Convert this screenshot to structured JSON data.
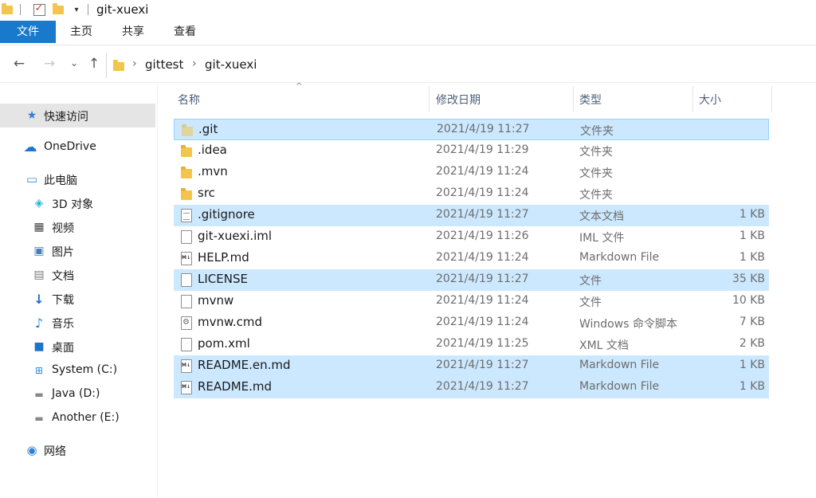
{
  "window": {
    "title": "git-xuexi"
  },
  "ribbon": {
    "tabs": [
      {
        "label": "文件",
        "active": true
      },
      {
        "label": "主页"
      },
      {
        "label": "共享"
      },
      {
        "label": "查看"
      }
    ]
  },
  "nav": {
    "back_icon": "arrow-left-icon",
    "forward_icon": "arrow-right-icon",
    "recent_icon": "chevron-down-icon",
    "up_icon": "arrow-up-icon",
    "breadcrumb": [
      "gittest",
      "git-xuexi"
    ]
  },
  "sidebar": {
    "items": [
      {
        "label": "快速访问",
        "icon": "star-icon",
        "selected": true
      },
      {
        "label": "OneDrive",
        "icon": "cloud-icon"
      },
      {
        "label": "此电脑",
        "icon": "computer-icon"
      },
      {
        "label": "3D 对象",
        "icon": "cube-icon"
      },
      {
        "label": "视频",
        "icon": "film-icon"
      },
      {
        "label": "图片",
        "icon": "picture-icon"
      },
      {
        "label": "文档",
        "icon": "document-icon"
      },
      {
        "label": "下载",
        "icon": "download-icon"
      },
      {
        "label": "音乐",
        "icon": "music-icon"
      },
      {
        "label": "桌面",
        "icon": "desktop-icon"
      },
      {
        "label": "System (C:)",
        "icon": "windows-drive-icon"
      },
      {
        "label": "Java (D:)",
        "icon": "drive-icon"
      },
      {
        "label": "Another (E:)",
        "icon": "drive-icon"
      },
      {
        "label": "网络",
        "icon": "network-icon"
      }
    ]
  },
  "columns": {
    "name": "名称",
    "date": "修改日期",
    "type": "类型",
    "size": "大小"
  },
  "files": [
    {
      "name": ".git",
      "date": "2021/4/19 11:27",
      "type": "文件夹",
      "size": "",
      "icon": "folder-icon",
      "selected": true,
      "faded": true
    },
    {
      "name": ".idea",
      "date": "2021/4/19 11:29",
      "type": "文件夹",
      "size": "",
      "icon": "folder-icon"
    },
    {
      "name": ".mvn",
      "date": "2021/4/19 11:24",
      "type": "文件夹",
      "size": "",
      "icon": "folder-icon"
    },
    {
      "name": "src",
      "date": "2021/4/19 11:24",
      "type": "文件夹",
      "size": "",
      "icon": "folder-icon"
    },
    {
      "name": ".gitignore",
      "date": "2021/4/19 11:27",
      "type": "文本文档",
      "size": "1 KB",
      "icon": "text-file-icon",
      "selected": true
    },
    {
      "name": "git-xuexi.iml",
      "date": "2021/4/19 11:26",
      "type": "IML 文件",
      "size": "1 KB",
      "icon": "file-icon"
    },
    {
      "name": "HELP.md",
      "date": "2021/4/19 11:24",
      "type": "Markdown File",
      "size": "1 KB",
      "icon": "markdown-file-icon"
    },
    {
      "name": "LICENSE",
      "date": "2021/4/19 11:27",
      "type": "文件",
      "size": "35 KB",
      "icon": "file-icon",
      "selected": true
    },
    {
      "name": "mvnw",
      "date": "2021/4/19 11:24",
      "type": "文件",
      "size": "10 KB",
      "icon": "file-icon"
    },
    {
      "name": "mvnw.cmd",
      "date": "2021/4/19 11:24",
      "type": "Windows 命令脚本",
      "size": "7 KB",
      "icon": "script-file-icon"
    },
    {
      "name": "pom.xml",
      "date": "2021/4/19 11:25",
      "type": "XML 文档",
      "size": "2 KB",
      "icon": "file-icon"
    },
    {
      "name": "README.en.md",
      "date": "2021/4/19 11:27",
      "type": "Markdown File",
      "size": "1 KB",
      "icon": "markdown-file-icon",
      "selected": true
    },
    {
      "name": "README.md",
      "date": "2021/4/19 11:27",
      "type": "Markdown File",
      "size": "1 KB",
      "icon": "markdown-file-icon",
      "selected": true
    }
  ]
}
